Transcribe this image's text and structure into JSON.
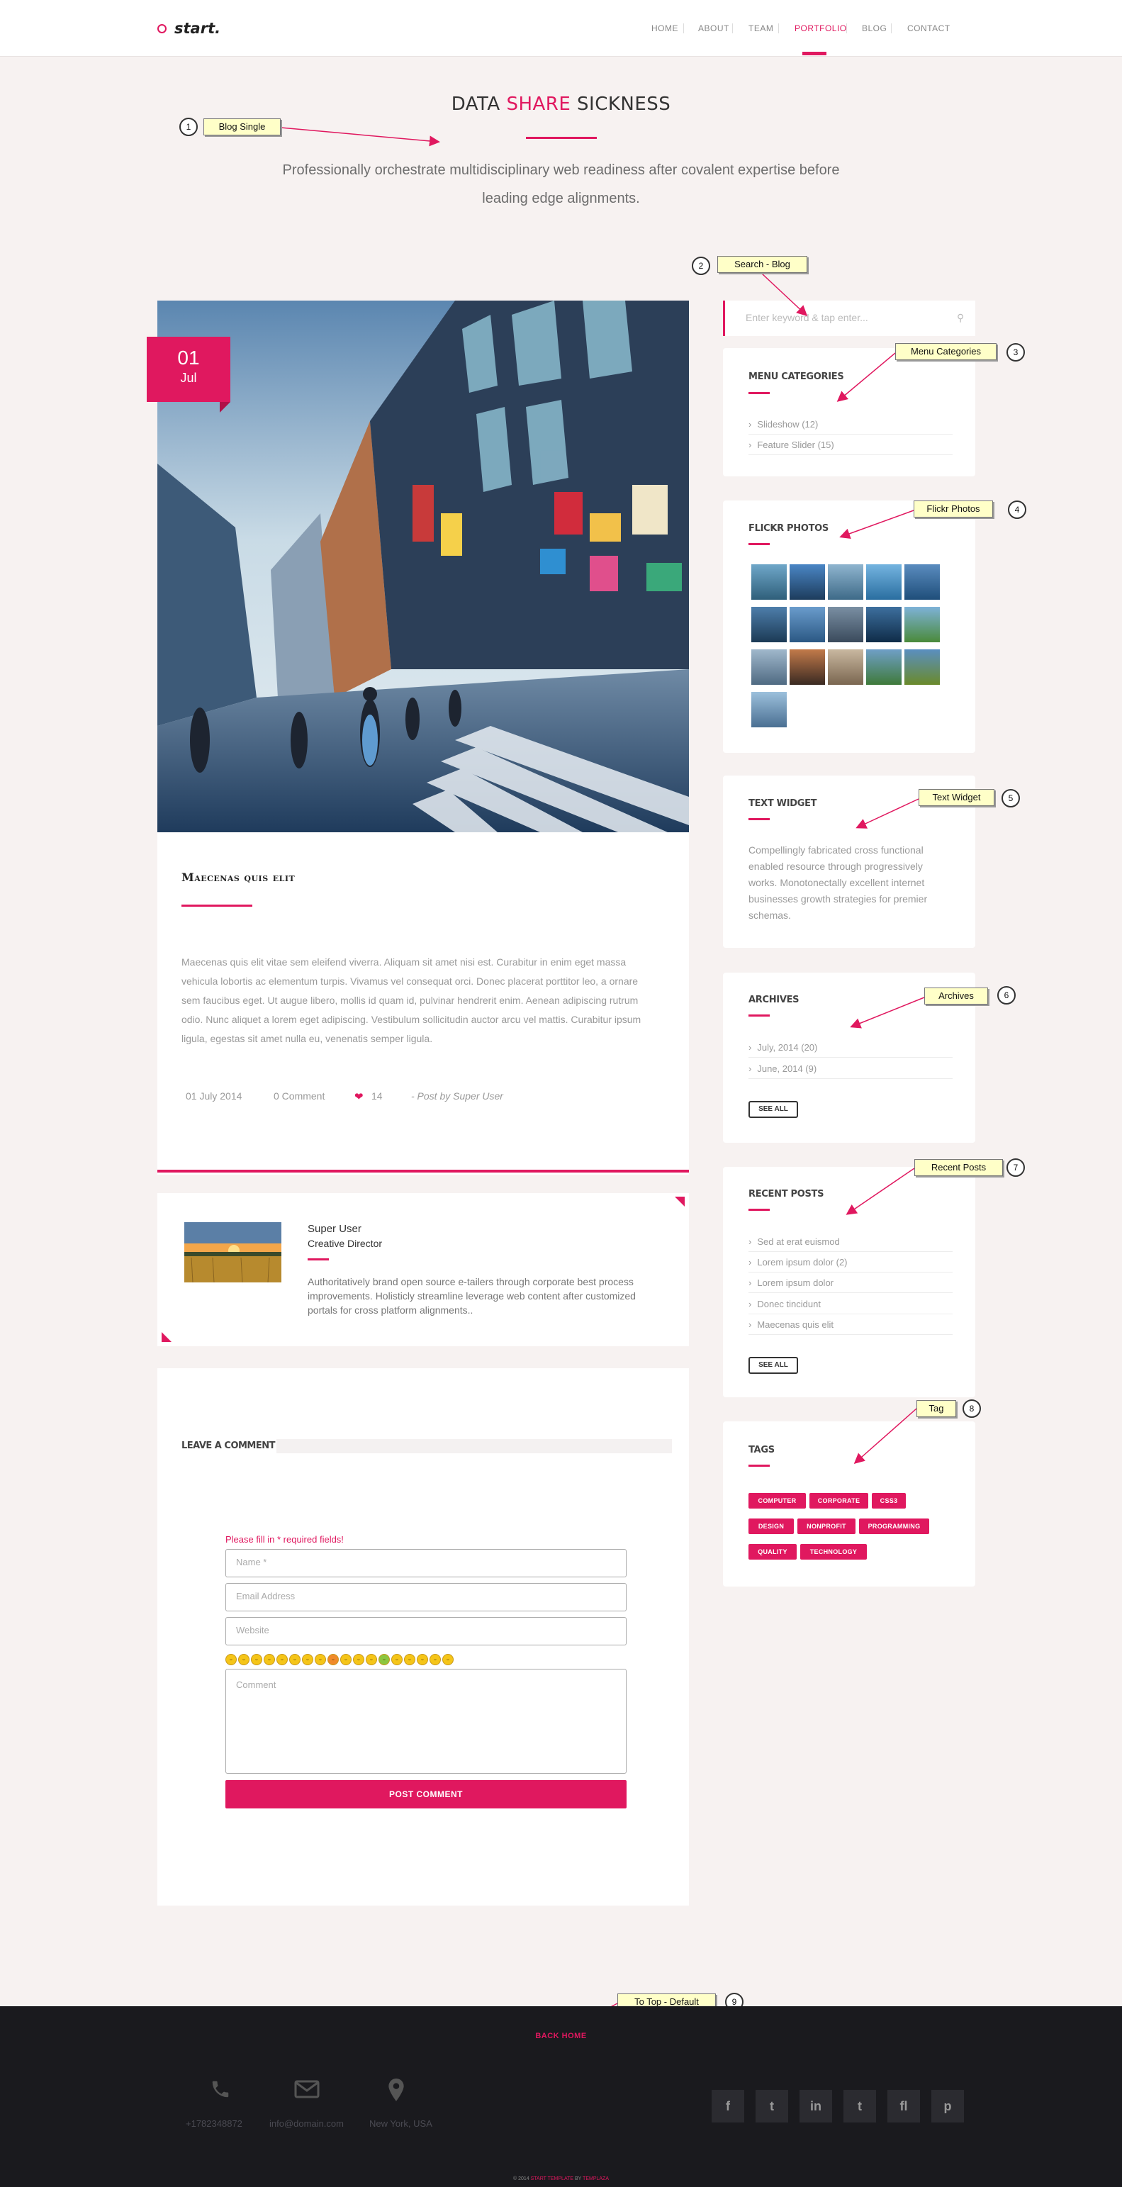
{
  "header": {
    "logo": "start.",
    "nav": [
      "HOME",
      "ABOUT",
      "TEAM",
      "PORTFOLIO",
      "BLOG",
      "CONTACT"
    ],
    "active": "PORTFOLIO"
  },
  "hero": {
    "title_pre": "DATA ",
    "title_accent": "SHARE",
    "title_post": " SICKNESS",
    "subtitle": "Professionally orchestrate multidisciplinary web readiness after covalent expertise before leading edge alignments."
  },
  "post": {
    "date_day": "01",
    "date_month": "Jul",
    "title": "Maecenas quis elit",
    "body": "Maecenas quis elit vitae sem eleifend viverra. Aliquam sit amet nisi est. Curabitur in enim eget massa vehicula lobortis ac elementum turpis. Vivamus vel consequat orci. Donec placerat porttitor leo, a ornare sem faucibus eget. Ut augue libero, mollis id quam id, pulvinar hendrerit enim. Aenean adipiscing rutrum odio. Nunc aliquet a lorem eget adipiscing. Vestibulum sollicitudin auctor arcu vel mattis. Curabitur ipsum ligula, egestas sit amet nulla eu, venenatis semper ligula.",
    "meta_date": "01 July 2014",
    "meta_comments": "0 Comment",
    "meta_likes": "14",
    "meta_author": "- Post by Super User"
  },
  "author": {
    "name": "Super User",
    "role": "Creative Director",
    "bio": "Authoritatively brand open source e-tailers through corporate best process improvements. Holisticly streamline leverage web content after customized portals for cross platform alignments.."
  },
  "comment": {
    "title": "LEAVE A COMMENT",
    "required": "Please fill in * required fields!",
    "name_ph": "Name *",
    "email_ph": "Email Address",
    "website_ph": "Website",
    "comment_ph": "Comment",
    "submit": "POST COMMENT"
  },
  "sidebar": {
    "search_ph": "Enter keyword & tap enter...",
    "menu_title": "MENU CATEGORIES",
    "menu_items": [
      "Slideshow (12)",
      "Feature Slider (15)"
    ],
    "flickr_title": "FLICKR PHOTOS",
    "text_title": "TEXT WIDGET",
    "text_body": "Compellingly fabricated cross functional enabled resource through progressively works. Monotonectally excellent internet businesses growth strategies for premier schemas.",
    "archives_title": "ARCHIVES",
    "archives": [
      "July, 2014 (20)",
      "June, 2014 (9)"
    ],
    "see_all": "SEE ALL",
    "recent_title": "RECENT POSTS",
    "recent": [
      "Sed at erat euismod",
      "Lorem ipsum dolor (2)",
      "Lorem ipsum dolor",
      "Donec tincidunt",
      "Maecenas quis elit"
    ],
    "tags_title": "TAGS",
    "tags": [
      "COMPUTER",
      "CORPORATE",
      "CSS3",
      "DESIGN",
      "NONPROFIT",
      "PROGRAMMING",
      "QUALITY",
      "TECHNOLOGY"
    ]
  },
  "annotations": [
    {
      "n": "1",
      "label": "Blog Single"
    },
    {
      "n": "2",
      "label": "Search - Blog"
    },
    {
      "n": "3",
      "label": "Menu Categories"
    },
    {
      "n": "4",
      "label": "Flickr Photos"
    },
    {
      "n": "5",
      "label": "Text Widget"
    },
    {
      "n": "6",
      "label": "Archives"
    },
    {
      "n": "7",
      "label": "Recent Posts"
    },
    {
      "n": "8",
      "label": "Tag"
    },
    {
      "n": "9",
      "label": "To Top - Default"
    }
  ],
  "footer": {
    "back_home": "BACK HOME",
    "phone": "+1782348872",
    "email": "info@domain.com",
    "location": "New York, USA",
    "social": [
      "f",
      "t",
      "in",
      "t",
      "fl",
      "p"
    ],
    "copy_pre": "© 2014 ",
    "copy_brand": "START TEMPLATE",
    "copy_mid": " BY ",
    "copy_author": "TEMPLAZA"
  },
  "colors": {
    "accent": "#e0185f",
    "footer": "#1a1a1e",
    "page": "#f7f2f1"
  }
}
